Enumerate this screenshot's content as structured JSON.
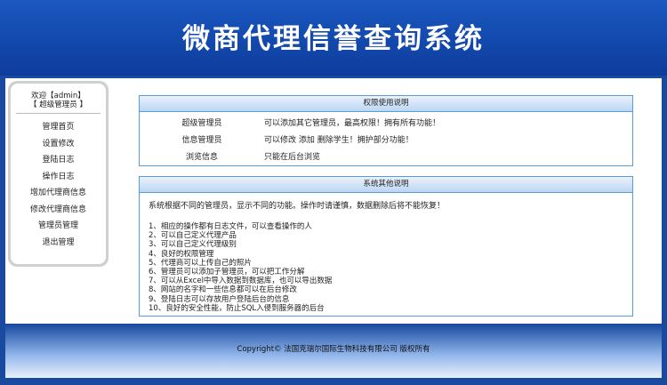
{
  "app_title": "微商代理信誉查询系统",
  "sidebar": {
    "welcome_line1": "欢迎【admin】",
    "welcome_line2": "【 超级管理员 】",
    "items": [
      {
        "label": "管理首页"
      },
      {
        "label": "设置修改"
      },
      {
        "label": "登陆日志"
      },
      {
        "label": "操作日志"
      },
      {
        "label": "增加代理商信息"
      },
      {
        "label": "修改代理商信息"
      },
      {
        "label": "管理员管理"
      },
      {
        "label": "退出管理"
      }
    ]
  },
  "permissions": {
    "header": "权限使用说明",
    "rows": [
      {
        "role": "超级管理员",
        "desc": "可以添加其它管理员，最高权限！拥有所有功能！"
      },
      {
        "role": "信息管理员",
        "desc": "可以修改 添加 删除学生！拥护部分功能！"
      },
      {
        "role": "浏览信息",
        "desc": "只能在后台浏览"
      }
    ]
  },
  "notes": {
    "header": "系统其他说明",
    "intro": "系统根据不同的管理员，显示不同的功能。操作时请谨慎，数据删除后将不能恢复！",
    "items": [
      "1、相应的操作都有日志文件，可以查看操作的人",
      "2、可以自己定义代理产品",
      "3、可以自己定义代理级别",
      "4、良好的权限管理",
      "5、代理商可以上传自己的照片",
      "6、管理员可以添加子管理员，可以把工作分解",
      "7、可以从Excel中导入数据到数据库，也可以导出数据",
      "8、网站的名字和一些信息都可以在后台修改",
      "9、登陆日志可以存放用户登陆后台的信息",
      "10、良好的安全性能，防止SQL入侵到服务器的后台"
    ]
  },
  "footer": {
    "copyright": "Copyright© 法国克瑞尔国际生物科技有限公司 版权所有"
  }
}
